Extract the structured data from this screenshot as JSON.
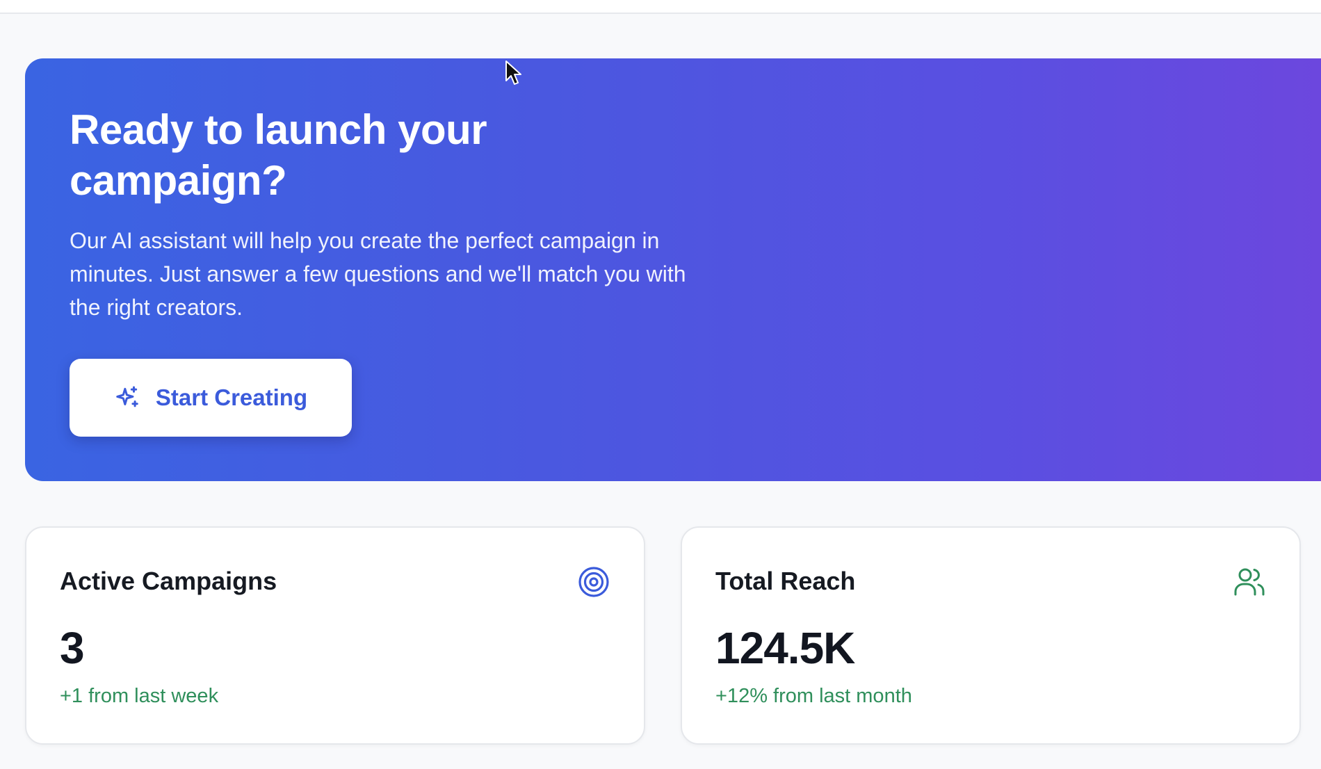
{
  "hero": {
    "title": "Ready to launch your campaign?",
    "description": "Our AI assistant will help you create the perfect campaign in minutes. Just answer a few questions and we'll match you with the right creators.",
    "button_label": "Start Creating",
    "button_icon": "sparkles-icon",
    "gradient_start": "#3a64e2",
    "gradient_end": "#6c47de"
  },
  "stats": {
    "active_campaigns": {
      "title": "Active Campaigns",
      "value": "3",
      "change": "+1 from last week",
      "icon": "target-icon",
      "icon_color": "#3b5bdb"
    },
    "total_reach": {
      "title": "Total Reach",
      "value": "124.5K",
      "change": "+12% from last month",
      "icon": "users-icon",
      "icon_color": "#2f8f5b"
    }
  },
  "colors": {
    "positive": "#2f8f5b",
    "accent": "#3b5bdb"
  }
}
